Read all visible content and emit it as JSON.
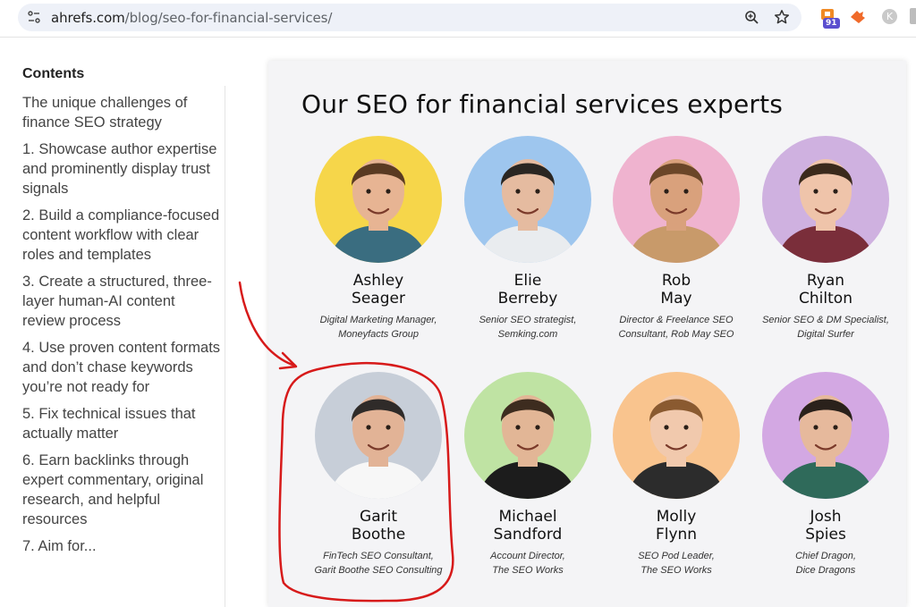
{
  "browser": {
    "url_host": "ahrefs.com",
    "url_path": "/blog/seo-for-financial-services/",
    "extension_badge": "91",
    "profile_initial": "K"
  },
  "toc": {
    "heading": "Contents",
    "items": [
      "The unique challenges of finance SEO strategy",
      "1. Showcase author expertise and prominently display trust signals",
      "2. Build a compliance-focused content workflow with clear roles and templates",
      "3. Create a structured, three-layer human-AI content review process",
      "4. Use proven content formats and don’t chase keywords you’re not ready for",
      "5. Fix technical issues that actually matter",
      "6. Earn backlinks through expert commentary, original research, and helpful resources",
      "7. Aim for..."
    ]
  },
  "main": {
    "title": "Our SEO for financial services experts",
    "experts": [
      {
        "name": "Ashley\nSeager",
        "role": "Digital Marketing Manager,\nMoneyfacts Group",
        "bg": "#f6d64a",
        "skin": "#e7b493",
        "hair": "#5a3a22",
        "shirt": "#3a6d80"
      },
      {
        "name": "Elie\nBerreby",
        "role": "Senior SEO strategist,\nSemking.com",
        "bg": "#9ec6ee",
        "skin": "#e5bba0",
        "hair": "#2a2622",
        "shirt": "#e9ecef"
      },
      {
        "name": "Rob\nMay",
        "role": "Director & Freelance SEO\nConsultant, Rob May SEO",
        "bg": "#efb3cf",
        "skin": "#d9a17c",
        "hair": "#6b4628",
        "shirt": "#c89a6a"
      },
      {
        "name": "Ryan\nChilton",
        "role": "Senior SEO & DM Specialist,\nDigital Surfer",
        "bg": "#cfb1e0",
        "skin": "#efc4aa",
        "hair": "#3b2a1c",
        "shirt": "#7a2e3a"
      },
      {
        "name": "Garit\nBoothe",
        "role": "FinTech SEO Consultant,\nGarit Boothe SEO Consulting",
        "bg": "#c7ced8",
        "skin": "#e2b396",
        "hair": "#2f2b29",
        "shirt": "#f7f7f7"
      },
      {
        "name": "Michael\nSandford",
        "role": "Account Director,\nThe SEO Works",
        "bg": "#bfe3a3",
        "skin": "#e2b696",
        "hair": "#3d2c1f",
        "shirt": "#1c1c1c"
      },
      {
        "name": "Molly\nFlynn",
        "role": "SEO Pod Leader,\nThe SEO Works",
        "bg": "#f9c48e",
        "skin": "#f1c9ad",
        "hair": "#8a5a30",
        "shirt": "#2c2c2c"
      },
      {
        "name": "Josh\nSpies",
        "role": "Chief Dragon,\nDice Dragons",
        "bg": "#d3a8e3",
        "skin": "#e6b99c",
        "hair": "#2a211b",
        "shirt": "#2f6a5a"
      }
    ]
  }
}
